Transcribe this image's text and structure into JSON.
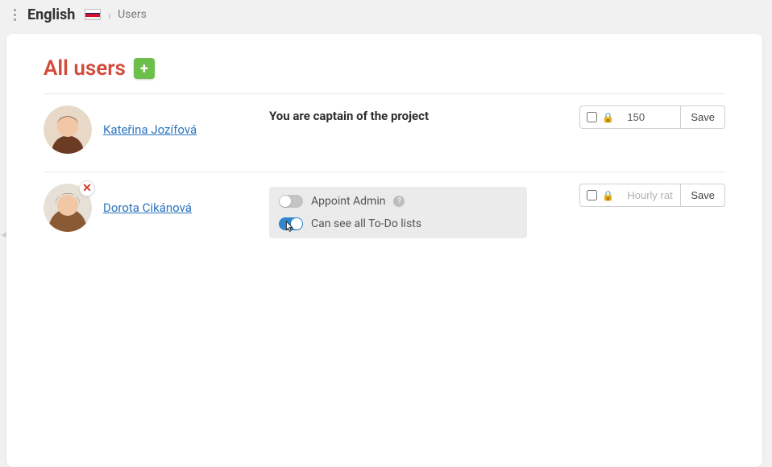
{
  "header": {
    "brand": "English",
    "breadcrumb": "Users"
  },
  "page": {
    "title": "All users",
    "add_icon_label": "+"
  },
  "users": [
    {
      "name": "Kateřina Jozífová",
      "captain_text": "You are captain of the project",
      "rate_value": "150",
      "rate_placeholder": "Hourly rat",
      "save_label": "Save"
    },
    {
      "name": "Dorota Cikánová",
      "perm_admin_label": "Appoint Admin",
      "perm_todo_label": "Can see all To-Do lists",
      "rate_value": "",
      "rate_placeholder": "Hourly rat",
      "save_label": "Save"
    }
  ],
  "icons": {
    "help": "?",
    "remove": "✕"
  }
}
